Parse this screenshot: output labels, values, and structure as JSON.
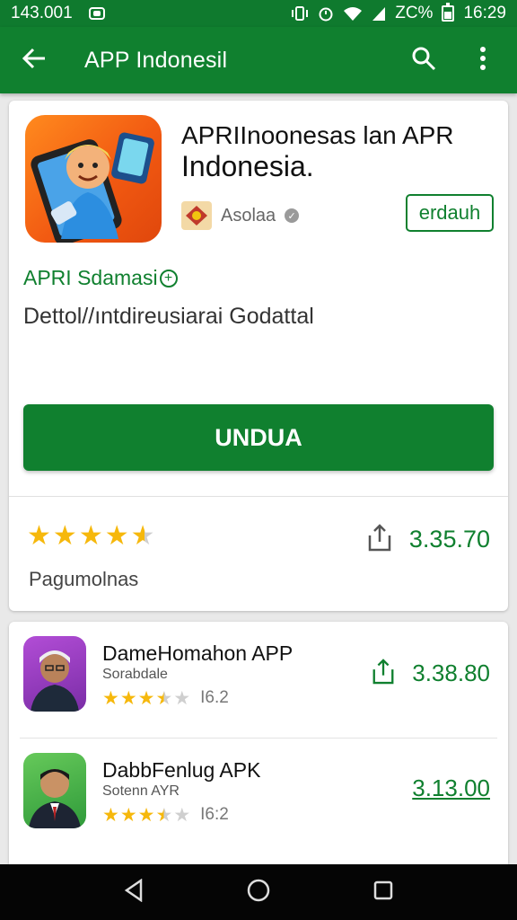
{
  "status_bar": {
    "left_text": "143.001",
    "right_text": "ZC%",
    "time": "16:29"
  },
  "app_bar": {
    "title": "APP Indonesil",
    "back_icon": "arrow-left-icon",
    "search_icon": "search-icon",
    "menu_icon": "more-vert-icon"
  },
  "app": {
    "title_line1": "APRIInoonesas lan APR",
    "title_line2": "Indonesia.",
    "developer": "Asolaa",
    "small_button": "erdauh",
    "category": "APRI Sdamasi",
    "description": "Dettol//ıntdireusiarai Godattal",
    "install_button": "UNDUA",
    "rating_value": 4.7,
    "rating_label": "Pagumolnas",
    "share_count": "3.35.70"
  },
  "related": [
    {
      "title": "DameHomahon APP",
      "subtitle": "Sorabdale",
      "rating": "I6.2",
      "stars": 3.5,
      "count": "3.38.80",
      "show_share": true
    },
    {
      "title": "DabbFenlug APK",
      "subtitle": "Sotenn AYR",
      "rating": "I6:2",
      "stars": 3.5,
      "count": "3.13.00",
      "show_share": false
    }
  ],
  "nav_bar": {
    "back_icon": "nav-back-icon",
    "home_icon": "nav-home-icon",
    "recents_icon": "nav-recents-icon"
  },
  "colors": {
    "primary_green": "#10802f",
    "star_yellow": "#f6b80c"
  }
}
